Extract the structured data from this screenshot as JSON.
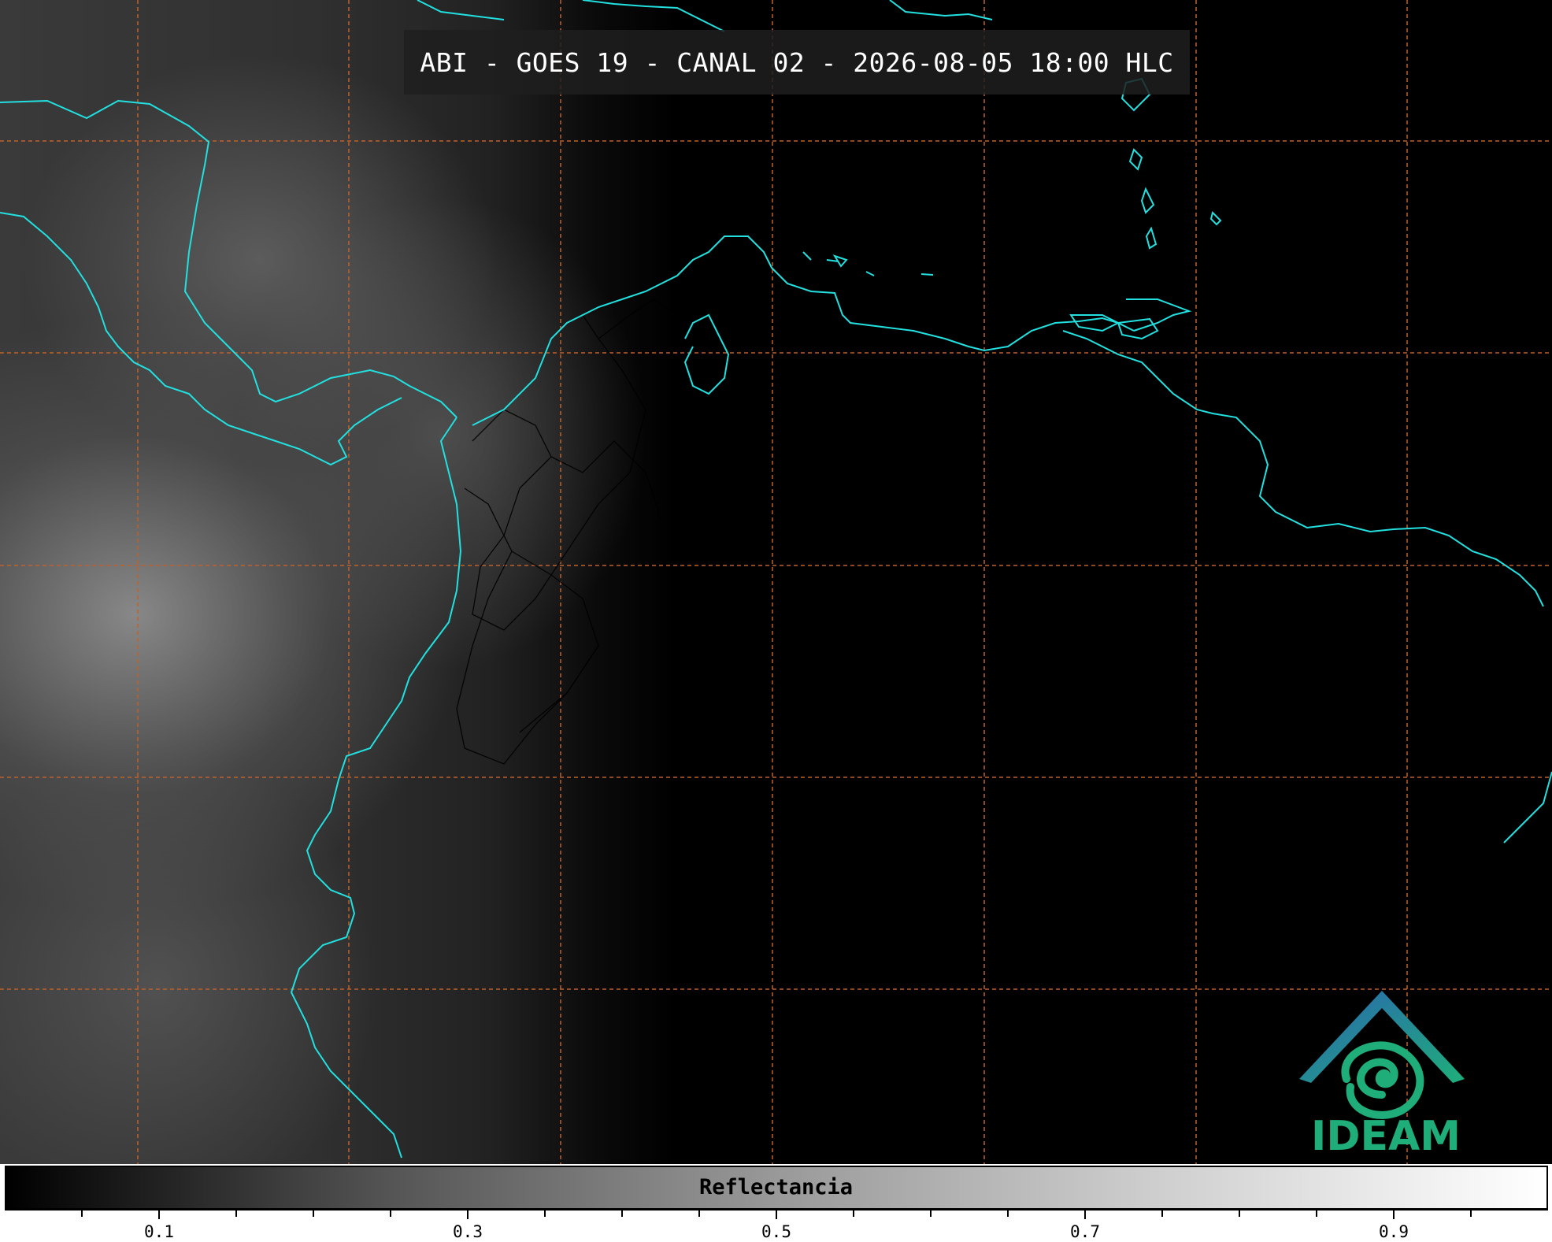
{
  "title": "ABI - GOES 19 - CANAL 02 - 2026-08-05 18:00 HLC",
  "logo": {
    "text": "IDEAM",
    "colors": {
      "arch": "#2a66b0",
      "swirl": "#1fae7a"
    }
  },
  "colorbar": {
    "label": "Reflectancia",
    "range": [
      0.0,
      1.0
    ],
    "major_ticks": [
      0.1,
      0.3,
      0.5,
      0.7,
      0.9
    ],
    "tick_labels": [
      "0.1",
      "0.3",
      "0.5",
      "0.7",
      "0.9"
    ],
    "minor_step": 0.05,
    "colormap": "grayscale (black to white)"
  },
  "map": {
    "style": "visible satellite reflectance, grayscale",
    "coastline_color": "#22e0e0",
    "gridline_color": "#c0602a",
    "gridline_style": "dashed",
    "borders_color": "#000000"
  }
}
